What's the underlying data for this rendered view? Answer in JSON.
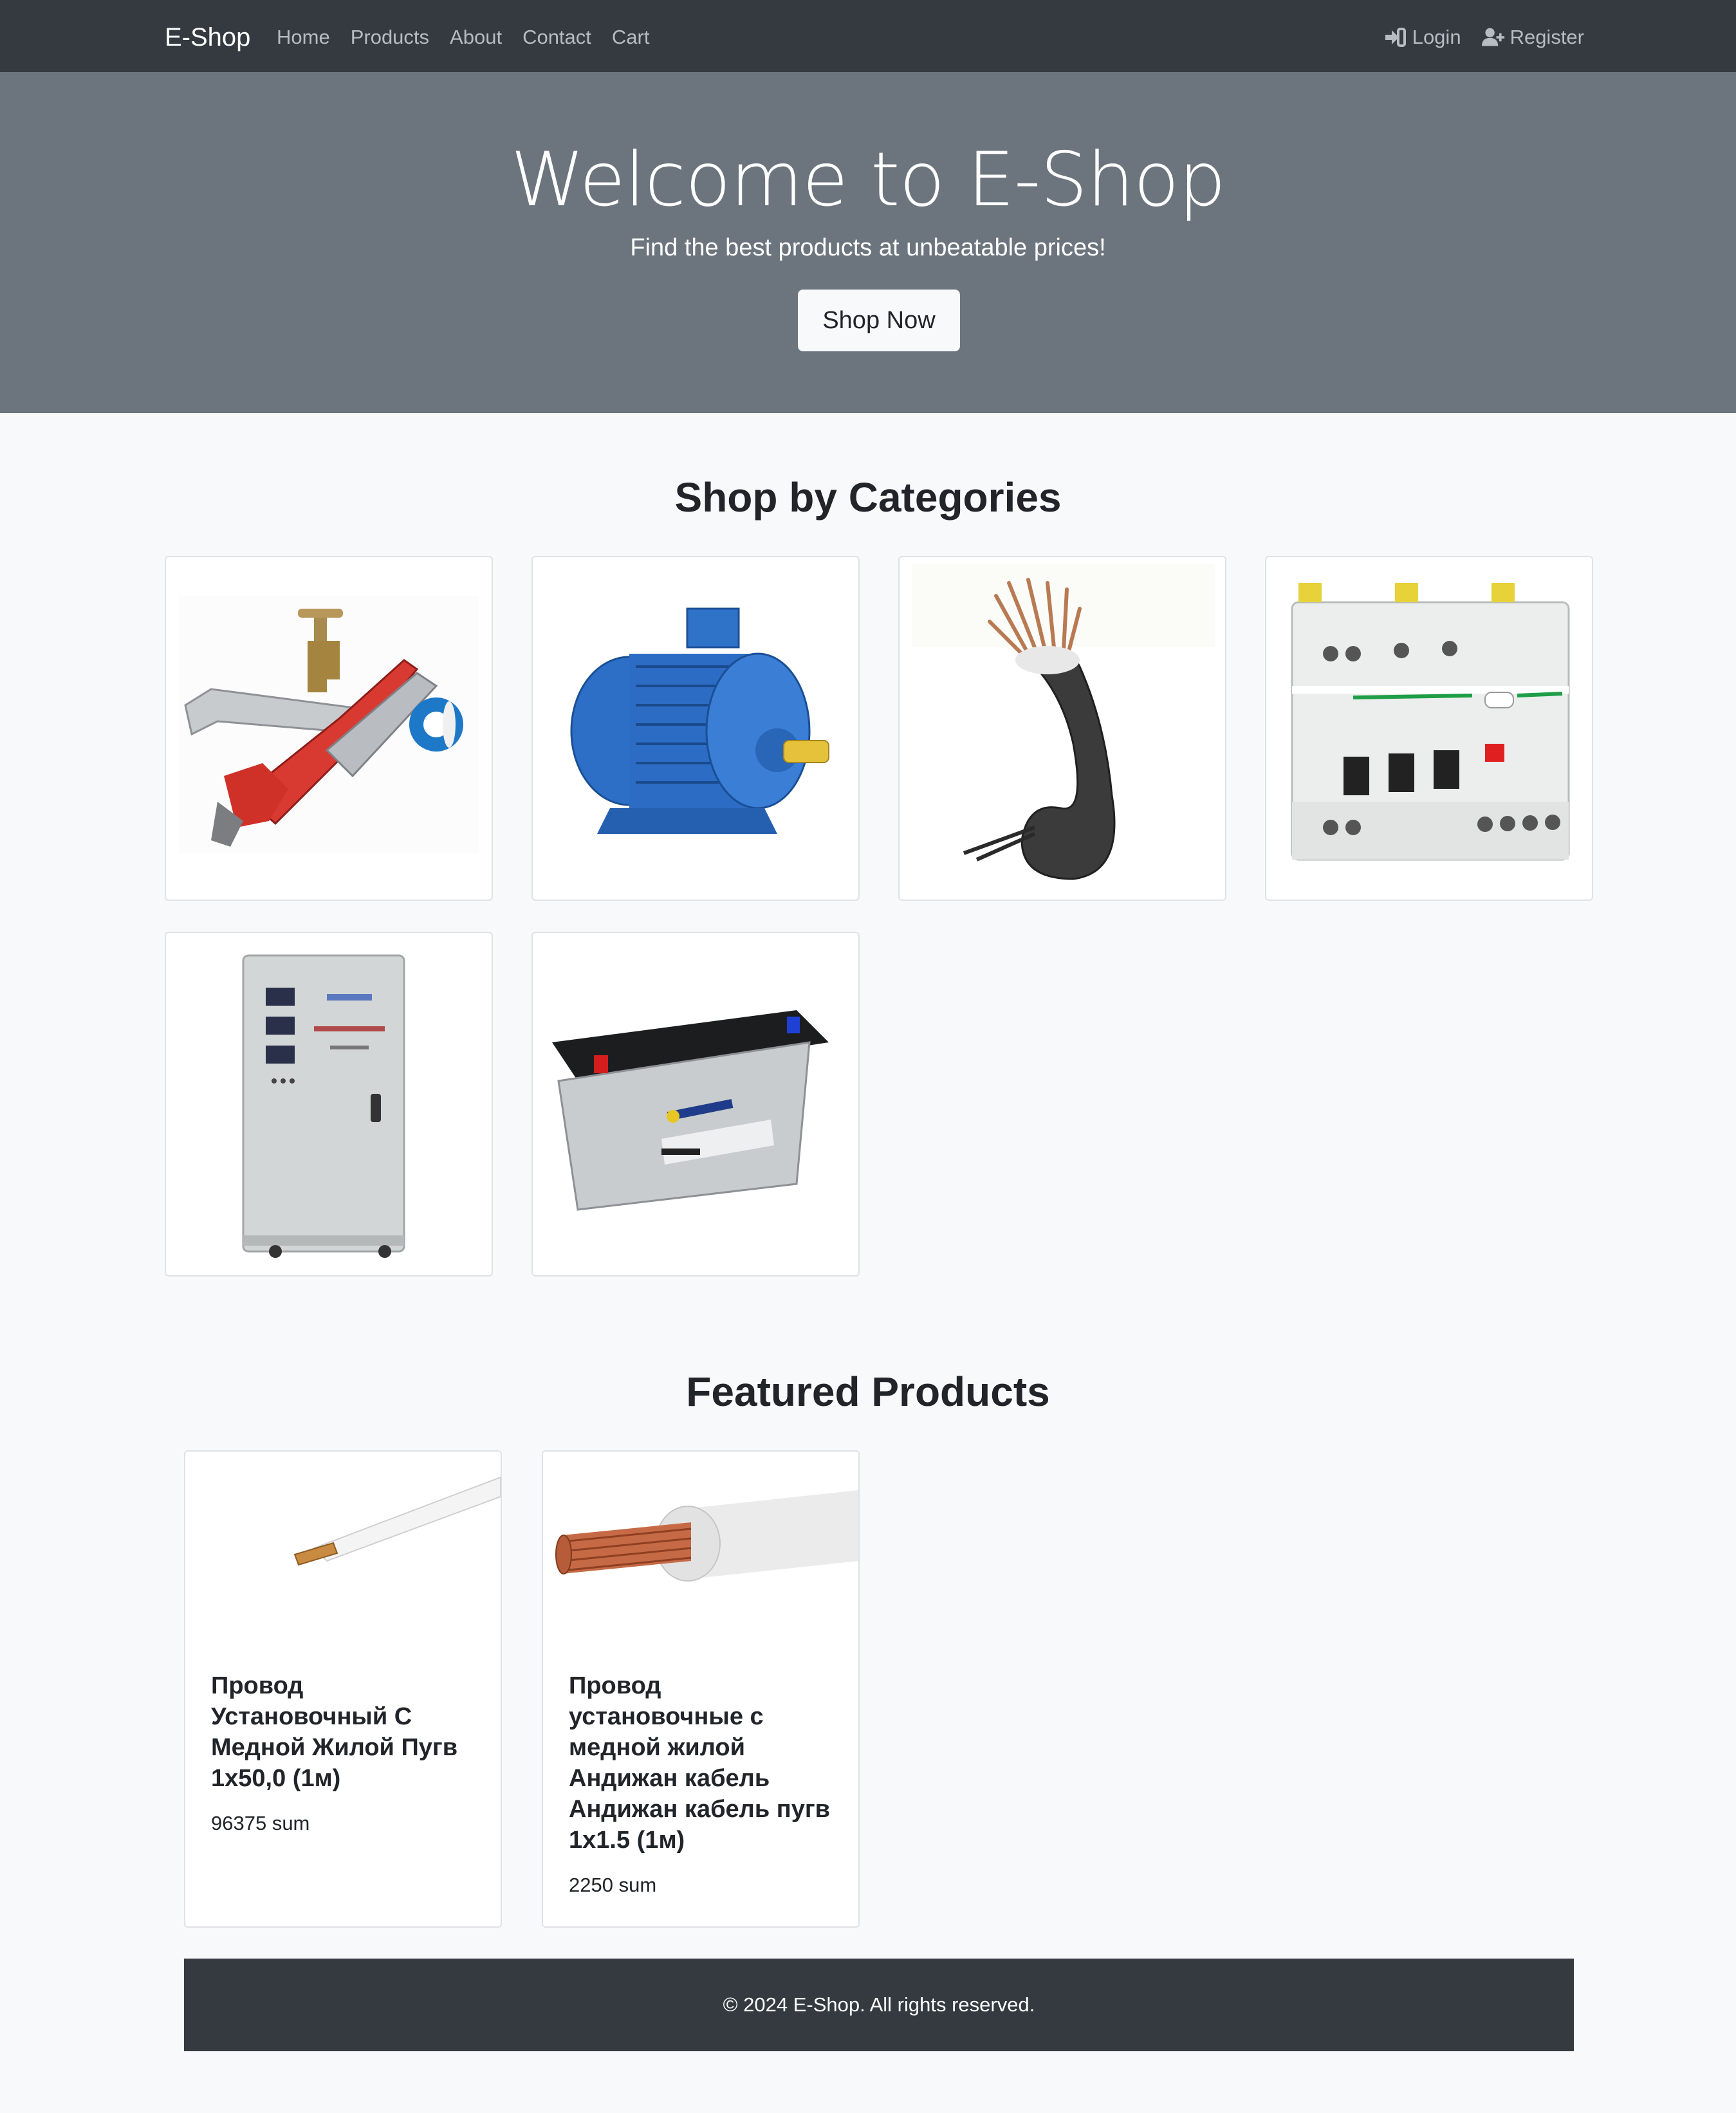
{
  "nav": {
    "brand": "E-Shop",
    "links": [
      "Home",
      "Products",
      "About",
      "Contact",
      "Cart"
    ],
    "login": "Login",
    "register": "Register"
  },
  "hero": {
    "title": "Welcome to E-Shop",
    "subtitle": "Find the best products at unbeatable prices!",
    "cta": "Shop Now"
  },
  "categories": {
    "title": "Shop by Categories",
    "items": [
      {
        "image": "plumbing-tools-image"
      },
      {
        "image": "electric-motor-image"
      },
      {
        "image": "cable-image"
      },
      {
        "image": "circuit-breaker-image"
      },
      {
        "image": "voltage-stabilizer-image"
      },
      {
        "image": "car-battery-image"
      }
    ]
  },
  "featured": {
    "title": "Featured Products",
    "items": [
      {
        "title": "Провод Установочный С Медной Жилой Пугв 1х50,0 (1м)",
        "price": "96375 sum",
        "image": "thin-wire-image"
      },
      {
        "title": "Провод установочные с медной жилой Андижан кабель Андижан кабель пугв 1x1.5 (1м)",
        "price": "2250 sum",
        "image": "stranded-wire-image"
      }
    ]
  },
  "footer": {
    "text": "© 2024 E-Shop. All rights reserved."
  }
}
